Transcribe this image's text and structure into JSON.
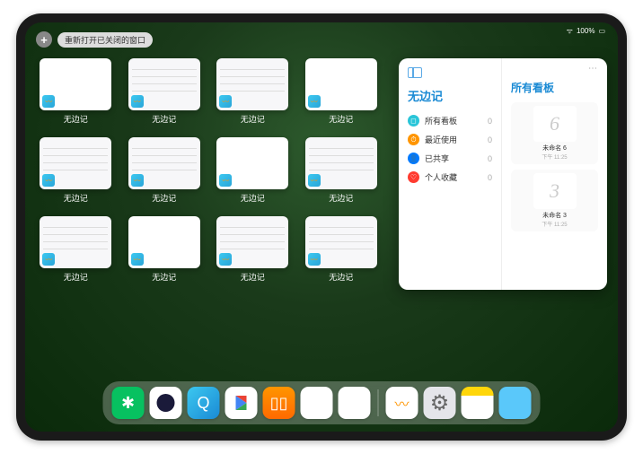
{
  "status": {
    "wifi": "⋮⋮",
    "battery": "100%"
  },
  "topbar": {
    "add": "+",
    "reopen_label": "重新打开已关闭的窗口"
  },
  "windows": [
    {
      "label": "无边记",
      "variant": "blank"
    },
    {
      "label": "无边记",
      "variant": "detailed"
    },
    {
      "label": "无边记",
      "variant": "detailed"
    },
    {
      "label": "无边记",
      "variant": "blank"
    },
    {
      "label": "无边记",
      "variant": "detailed"
    },
    {
      "label": "无边记",
      "variant": "detailed"
    },
    {
      "label": "无边记",
      "variant": "blank"
    },
    {
      "label": "无边记",
      "variant": "detailed"
    },
    {
      "label": "无边记",
      "variant": "detailed"
    },
    {
      "label": "无边记",
      "variant": "blank"
    },
    {
      "label": "无边记",
      "variant": "detailed"
    },
    {
      "label": "无边记",
      "variant": "detailed"
    }
  ],
  "panel": {
    "title": "无边记",
    "items": [
      {
        "icon": "cyan",
        "glyph": "◻",
        "label": "所有看板",
        "count": "0"
      },
      {
        "icon": "orange",
        "glyph": "⏱",
        "label": "最近使用",
        "count": "0"
      },
      {
        "icon": "blue",
        "glyph": "👤",
        "label": "已共享",
        "count": "0"
      },
      {
        "icon": "red",
        "glyph": "♡",
        "label": "个人收藏",
        "count": "0"
      }
    ],
    "main_title": "所有看板",
    "boards": [
      {
        "glyph": "6",
        "name": "未命名 6",
        "time": "下午 11:25"
      },
      {
        "glyph": "3",
        "name": "未命名 3",
        "time": "下午 11:25"
      }
    ],
    "more": "⋯"
  },
  "dock": {
    "apps": [
      {
        "name": "wechat",
        "cls": "di-wechat",
        "glyph": "✱"
      },
      {
        "name": "quark",
        "cls": "di-white",
        "glyph": "●"
      },
      {
        "name": "browser",
        "cls": "di-cyan",
        "glyph": "Q"
      },
      {
        "name": "play",
        "cls": "di-white",
        "glyph": ""
      },
      {
        "name": "books",
        "cls": "di-books",
        "glyph": "▯▯"
      },
      {
        "name": "dice",
        "cls": "di-white",
        "glyph": "⊡"
      },
      {
        "name": "connect",
        "cls": "di-white",
        "glyph": "⋈"
      }
    ],
    "recents": [
      {
        "name": "freeform",
        "cls": "di-freeform",
        "glyph": "〰"
      },
      {
        "name": "settings",
        "cls": "di-settings",
        "glyph": "⚙"
      },
      {
        "name": "notes",
        "cls": "di-notes",
        "glyph": ""
      },
      {
        "name": "app-library",
        "cls": "di-folder",
        "glyph": ""
      }
    ]
  }
}
